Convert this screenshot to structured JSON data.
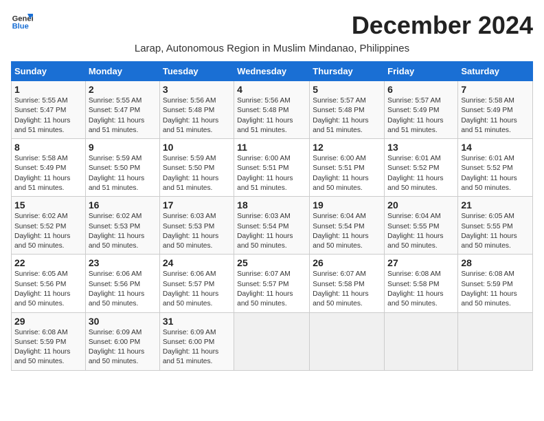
{
  "logo": {
    "line1": "General",
    "line2": "Blue"
  },
  "title": "December 2024",
  "subtitle": "Larap, Autonomous Region in Muslim Mindanao, Philippines",
  "days_of_week": [
    "Sunday",
    "Monday",
    "Tuesday",
    "Wednesday",
    "Thursday",
    "Friday",
    "Saturday"
  ],
  "weeks": [
    [
      {
        "day": "1",
        "info": "Sunrise: 5:55 AM\nSunset: 5:47 PM\nDaylight: 11 hours\nand 51 minutes."
      },
      {
        "day": "2",
        "info": "Sunrise: 5:55 AM\nSunset: 5:47 PM\nDaylight: 11 hours\nand 51 minutes."
      },
      {
        "day": "3",
        "info": "Sunrise: 5:56 AM\nSunset: 5:48 PM\nDaylight: 11 hours\nand 51 minutes."
      },
      {
        "day": "4",
        "info": "Sunrise: 5:56 AM\nSunset: 5:48 PM\nDaylight: 11 hours\nand 51 minutes."
      },
      {
        "day": "5",
        "info": "Sunrise: 5:57 AM\nSunset: 5:48 PM\nDaylight: 11 hours\nand 51 minutes."
      },
      {
        "day": "6",
        "info": "Sunrise: 5:57 AM\nSunset: 5:49 PM\nDaylight: 11 hours\nand 51 minutes."
      },
      {
        "day": "7",
        "info": "Sunrise: 5:58 AM\nSunset: 5:49 PM\nDaylight: 11 hours\nand 51 minutes."
      }
    ],
    [
      {
        "day": "8",
        "info": "Sunrise: 5:58 AM\nSunset: 5:49 PM\nDaylight: 11 hours\nand 51 minutes."
      },
      {
        "day": "9",
        "info": "Sunrise: 5:59 AM\nSunset: 5:50 PM\nDaylight: 11 hours\nand 51 minutes."
      },
      {
        "day": "10",
        "info": "Sunrise: 5:59 AM\nSunset: 5:50 PM\nDaylight: 11 hours\nand 51 minutes."
      },
      {
        "day": "11",
        "info": "Sunrise: 6:00 AM\nSunset: 5:51 PM\nDaylight: 11 hours\nand 51 minutes."
      },
      {
        "day": "12",
        "info": "Sunrise: 6:00 AM\nSunset: 5:51 PM\nDaylight: 11 hours\nand 50 minutes."
      },
      {
        "day": "13",
        "info": "Sunrise: 6:01 AM\nSunset: 5:52 PM\nDaylight: 11 hours\nand 50 minutes."
      },
      {
        "day": "14",
        "info": "Sunrise: 6:01 AM\nSunset: 5:52 PM\nDaylight: 11 hours\nand 50 minutes."
      }
    ],
    [
      {
        "day": "15",
        "info": "Sunrise: 6:02 AM\nSunset: 5:52 PM\nDaylight: 11 hours\nand 50 minutes."
      },
      {
        "day": "16",
        "info": "Sunrise: 6:02 AM\nSunset: 5:53 PM\nDaylight: 11 hours\nand 50 minutes."
      },
      {
        "day": "17",
        "info": "Sunrise: 6:03 AM\nSunset: 5:53 PM\nDaylight: 11 hours\nand 50 minutes."
      },
      {
        "day": "18",
        "info": "Sunrise: 6:03 AM\nSunset: 5:54 PM\nDaylight: 11 hours\nand 50 minutes."
      },
      {
        "day": "19",
        "info": "Sunrise: 6:04 AM\nSunset: 5:54 PM\nDaylight: 11 hours\nand 50 minutes."
      },
      {
        "day": "20",
        "info": "Sunrise: 6:04 AM\nSunset: 5:55 PM\nDaylight: 11 hours\nand 50 minutes."
      },
      {
        "day": "21",
        "info": "Sunrise: 6:05 AM\nSunset: 5:55 PM\nDaylight: 11 hours\nand 50 minutes."
      }
    ],
    [
      {
        "day": "22",
        "info": "Sunrise: 6:05 AM\nSunset: 5:56 PM\nDaylight: 11 hours\nand 50 minutes."
      },
      {
        "day": "23",
        "info": "Sunrise: 6:06 AM\nSunset: 5:56 PM\nDaylight: 11 hours\nand 50 minutes."
      },
      {
        "day": "24",
        "info": "Sunrise: 6:06 AM\nSunset: 5:57 PM\nDaylight: 11 hours\nand 50 minutes."
      },
      {
        "day": "25",
        "info": "Sunrise: 6:07 AM\nSunset: 5:57 PM\nDaylight: 11 hours\nand 50 minutes."
      },
      {
        "day": "26",
        "info": "Sunrise: 6:07 AM\nSunset: 5:58 PM\nDaylight: 11 hours\nand 50 minutes."
      },
      {
        "day": "27",
        "info": "Sunrise: 6:08 AM\nSunset: 5:58 PM\nDaylight: 11 hours\nand 50 minutes."
      },
      {
        "day": "28",
        "info": "Sunrise: 6:08 AM\nSunset: 5:59 PM\nDaylight: 11 hours\nand 50 minutes."
      }
    ],
    [
      {
        "day": "29",
        "info": "Sunrise: 6:08 AM\nSunset: 5:59 PM\nDaylight: 11 hours\nand 50 minutes."
      },
      {
        "day": "30",
        "info": "Sunrise: 6:09 AM\nSunset: 6:00 PM\nDaylight: 11 hours\nand 50 minutes."
      },
      {
        "day": "31",
        "info": "Sunrise: 6:09 AM\nSunset: 6:00 PM\nDaylight: 11 hours\nand 51 minutes."
      },
      {
        "day": "",
        "info": ""
      },
      {
        "day": "",
        "info": ""
      },
      {
        "day": "",
        "info": ""
      },
      {
        "day": "",
        "info": ""
      }
    ]
  ]
}
